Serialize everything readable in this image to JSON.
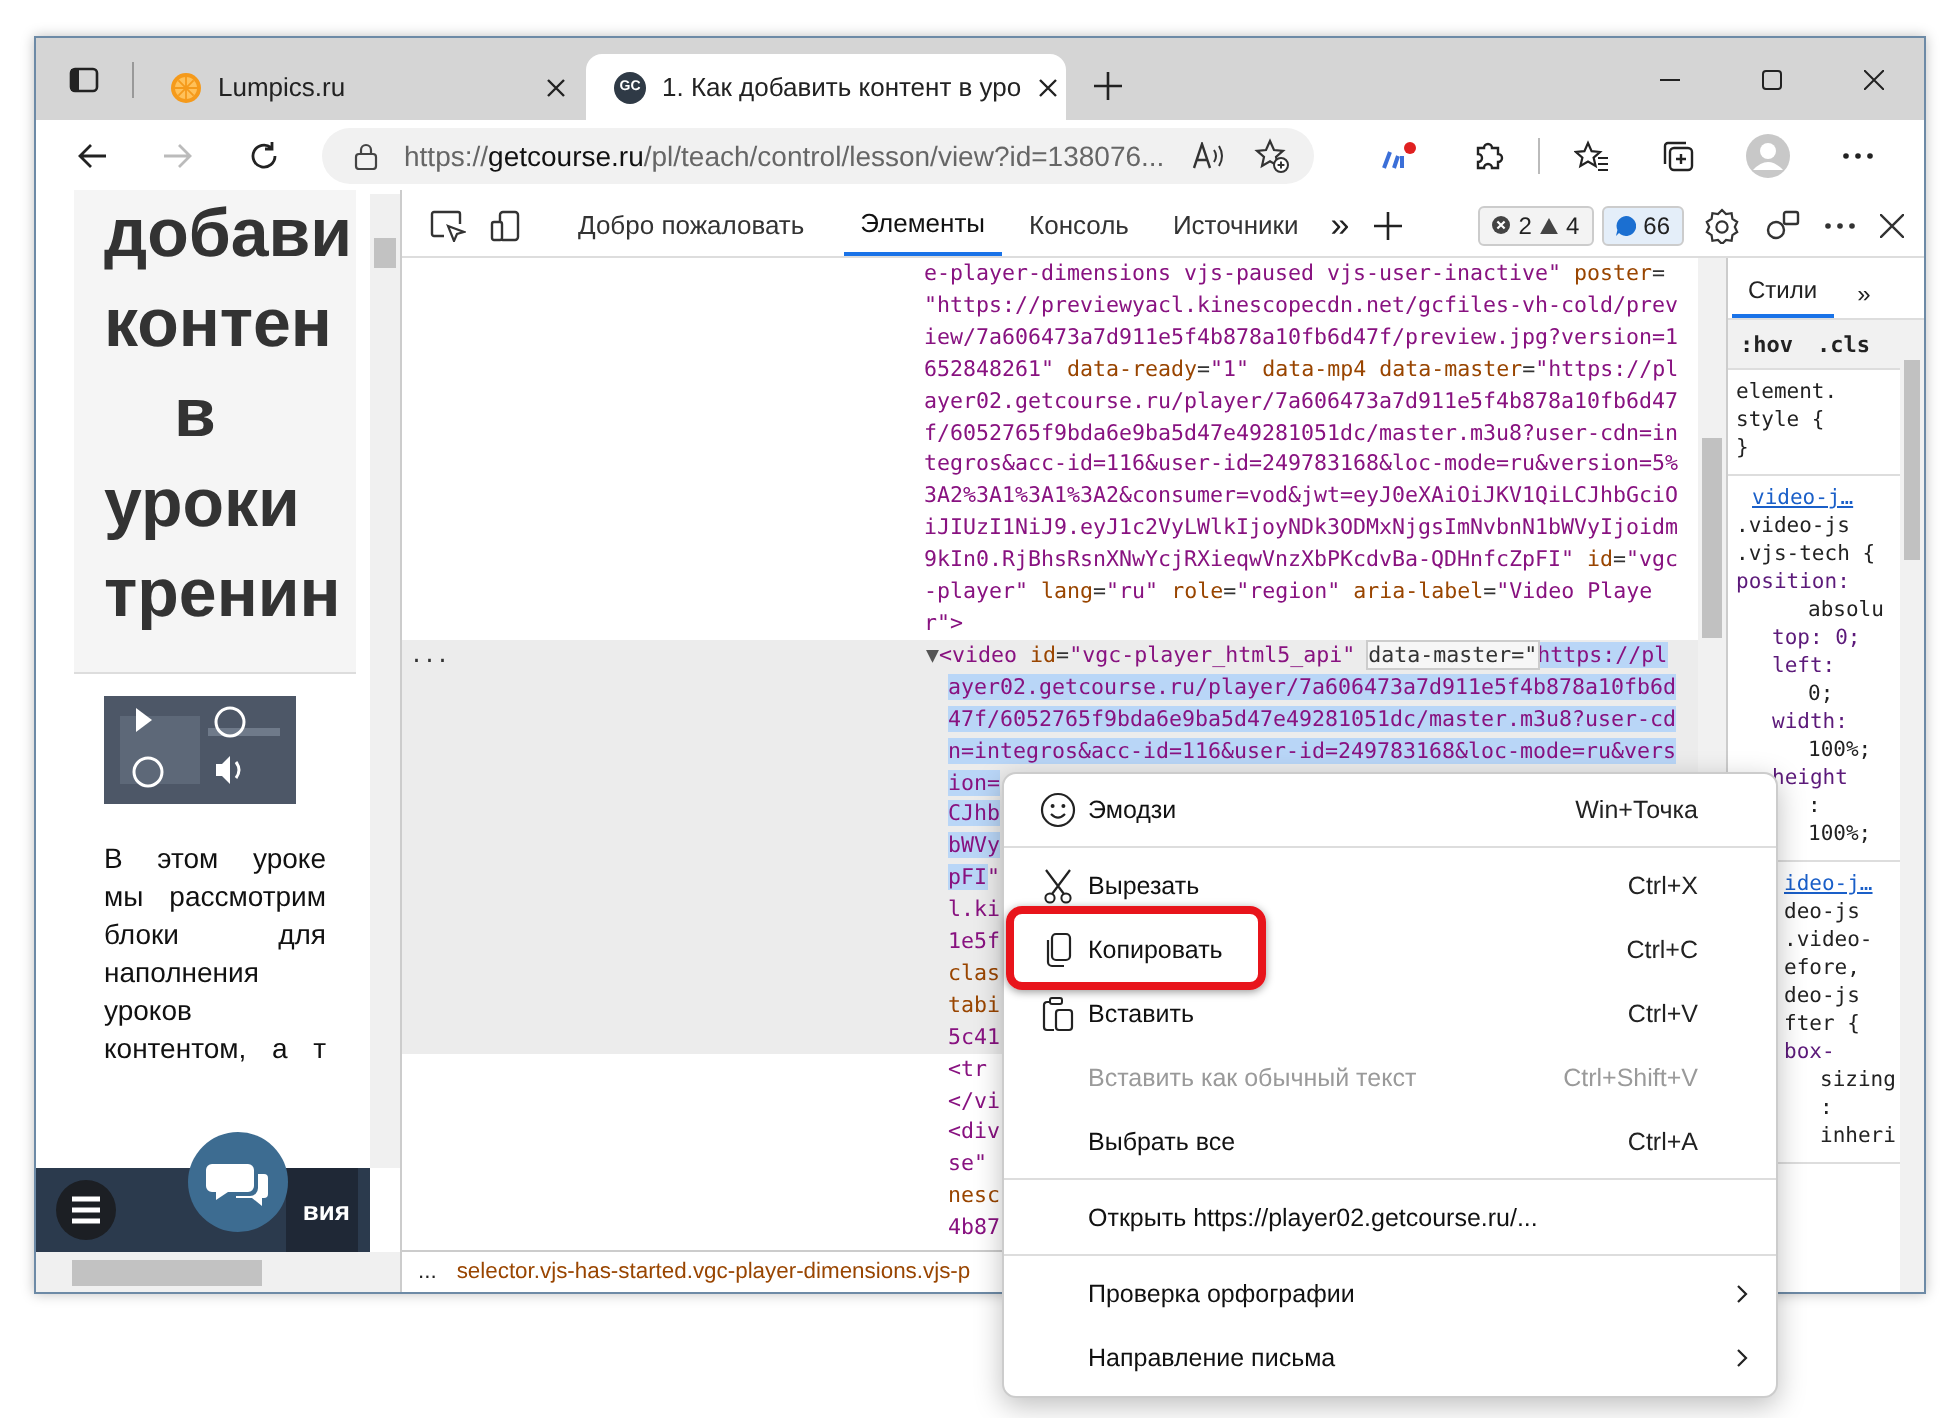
{
  "browser": {
    "tabs": [
      {
        "title": "Lumpics.ru",
        "selected": false,
        "kind": "orange"
      },
      {
        "title": "1. Как добавить контент в уро",
        "selected": true,
        "kind": "letters",
        "favicon_text": "GC"
      }
    ],
    "forward_disabled": true,
    "address": {
      "scheme": "https://",
      "domain": "getcourse.ru",
      "path": "/pl/teach/control/lesson/view?id=138076..."
    }
  },
  "page": {
    "heading_lines": [
      "добави",
      "контен",
      "в",
      "уроки",
      "тренин"
    ],
    "paragraph": "В этом уроке мы рассмотрим блоки для наполнения уроков контентом, а т",
    "bottom_bar_label": "вия"
  },
  "devtools": {
    "tabs": [
      {
        "label": "Добро пожаловать",
        "selected": false
      },
      {
        "label": "Элементы",
        "selected": true
      },
      {
        "label": "Консоль",
        "selected": false
      },
      {
        "label": "Источники",
        "selected": false
      }
    ],
    "overflow_label": "»",
    "errors": "2",
    "warnings": "4",
    "issues": "66",
    "node_marker": "...",
    "nodes": [
      {
        "selected": false,
        "lines": [
          [
            {
              "kind": "value",
              "text": "e-player-dimensions vjs-paused vjs-user-inactive\" "
            },
            {
              "kind": "attr",
              "text": "poster"
            },
            {
              "kind": "plain",
              "text": "="
            }
          ],
          [
            {
              "kind": "value",
              "text": "\"https://previewyacl.kinescopecdn.net/gcfiles-vh-cold/prev"
            }
          ],
          [
            {
              "kind": "value",
              "text": "iew/7a606473a7d911e5f4b878a10fb6d47f/preview.jpg?version=1"
            }
          ],
          [
            {
              "kind": "value",
              "text": "652848261\" "
            },
            {
              "kind": "attr",
              "text": "data-ready"
            },
            {
              "kind": "plain",
              "text": "="
            },
            {
              "kind": "value",
              "text": "\"1\" "
            },
            {
              "kind": "attr",
              "text": "data-mp4 data-master"
            },
            {
              "kind": "plain",
              "text": "="
            },
            {
              "kind": "value",
              "text": "\"https://pl"
            }
          ],
          [
            {
              "kind": "value",
              "text": "ayer02.getcourse.ru/player/7a606473a7d911e5f4b878a10fb6d47"
            }
          ],
          [
            {
              "kind": "value",
              "text": "f/6052765f9bda6e9ba5d47e49281051dc/master.m3u8?user-cdn=in"
            }
          ],
          [
            {
              "kind": "value",
              "text": "tegros&acc-id=116&user-id=249783168&loc-mode=ru&version=5%"
            }
          ],
          [
            {
              "kind": "value",
              "text": "3A2%3A1%3A1%3A2&consumer=vod&jwt=eyJ0eXAiOiJKV1QiLCJhbGciO"
            }
          ],
          [
            {
              "kind": "value",
              "text": "iJIUzI1NiJ9.eyJ1c2VyLWlkIjoyNDk3ODMxNjgsImNvbnN1bWVyIjoidm"
            }
          ],
          [
            {
              "kind": "value",
              "text": "9kIn0.RjBhsRsnXNwYcjRXieqwVnzXbPKcdvBa-QDHnfcZpFI\" "
            },
            {
              "kind": "attr",
              "text": "id"
            },
            {
              "kind": "plain",
              "text": "="
            },
            {
              "kind": "value",
              "text": "\"vgc"
            }
          ],
          [
            {
              "kind": "value",
              "text": "-player\" "
            },
            {
              "kind": "attr",
              "text": "lang"
            },
            {
              "kind": "plain",
              "text": "="
            },
            {
              "kind": "value",
              "text": "\"ru\" "
            },
            {
              "kind": "attr",
              "text": "role"
            },
            {
              "kind": "plain",
              "text": "="
            },
            {
              "kind": "value",
              "text": "\"region\" "
            },
            {
              "kind": "attr",
              "text": "aria-label"
            },
            {
              "kind": "plain",
              "text": "="
            },
            {
              "kind": "value",
              "text": "\"Video Playe"
            }
          ],
          [
            {
              "kind": "value",
              "text": "r\""
            },
            {
              "kind": "tag",
              "text": ">"
            }
          ]
        ]
      },
      {
        "selected": true,
        "lines": [
          [
            {
              "kind": "toggle",
              "text": "▼"
            },
            {
              "kind": "tag",
              "text": "<video "
            },
            {
              "kind": "attr",
              "text": "id"
            },
            {
              "kind": "plain",
              "text": "="
            },
            {
              "kind": "value",
              "text": "\"vgc-player_html5_api\" "
            },
            {
              "kind": "hover",
              "text": "data-master=\""
            },
            {
              "kind": "sel",
              "text": "https://pl"
            }
          ],
          [
            {
              "kind": "sel",
              "text": "ayer02.getcourse.ru/player/7a606473a7d911e5f4b878a10fb6d"
            }
          ],
          [
            {
              "kind": "sel",
              "text": "47f/6052765f9bda6e9ba5d47e49281051dc/master.m3u8?user-cd"
            }
          ],
          [
            {
              "kind": "sel",
              "text": "n=integros&acc-id=116&user-id=249783168&loc-mode=ru&vers"
            }
          ],
          [
            {
              "kind": "sel",
              "text": "ion="
            }
          ],
          [
            {
              "kind": "sel",
              "text": "CJhb"
            }
          ],
          [
            {
              "kind": "sel",
              "text": "bWVy"
            }
          ],
          [
            {
              "kind": "sel",
              "text": "pFI"
            },
            {
              "kind": "value",
              "text": "\""
            }
          ],
          [
            {
              "kind": "value",
              "text": "l.ki"
            }
          ],
          [
            {
              "kind": "value",
              "text": "1e5f"
            }
          ],
          [
            {
              "kind": "attr",
              "text": "clas"
            }
          ],
          [
            {
              "kind": "attr",
              "text": "tabi"
            }
          ],
          [
            {
              "kind": "value",
              "text": "5c41"
            }
          ]
        ]
      },
      {
        "selected": false,
        "lines": [
          [
            {
              "kind": "tag",
              "text": "<tr"
            }
          ],
          [
            {
              "kind": "tag",
              "text": "</vi"
            }
          ],
          [
            {
              "kind": "tag",
              "text": "<div"
            }
          ],
          [
            {
              "kind": "value",
              "text": "se\""
            }
          ],
          [
            {
              "kind": "attr",
              "text": "nesc"
            }
          ],
          [
            {
              "kind": "value",
              "text": "4b87"
            }
          ]
        ]
      }
    ],
    "breadcrumb": {
      "more": "...",
      "path": "selector.vjs-has-started.vgc-player-dimensions.vjs-p"
    },
    "styles": {
      "tabs": [
        {
          "label": "Стили",
          "selected": true
        },
        {
          "label": "»",
          "selected": false
        }
      ],
      "filters": [
        ":hov",
        ".cls"
      ],
      "rules": [
        {
          "obscured": false,
          "lines": [
            {
              "kind": "selector",
              "text": "element."
            },
            {
              "kind": "selector",
              "text": "style {"
            },
            {
              "kind": "selector",
              "text": "}"
            }
          ]
        },
        {
          "obscured": false,
          "lines": [
            {
              "kind": "link",
              "text": "video-j…"
            },
            {
              "kind": "selector",
              "text": ".video-js"
            },
            {
              "kind": "selector",
              "text": ".vjs-tech {"
            },
            {
              "kind": "prop",
              "text": "position:"
            },
            {
              "kind": "value",
              "text": "absolu"
            },
            {
              "kind": "subprop",
              "text": "top: 0;"
            },
            {
              "kind": "subprop",
              "text": "left:"
            },
            {
              "kind": "value",
              "text": "0;"
            },
            {
              "kind": "subprop",
              "text": "width:"
            },
            {
              "kind": "value",
              "text": "100%;"
            },
            {
              "kind": "subprop",
              "text": "height"
            },
            {
              "kind": "value",
              "text": ":"
            },
            {
              "kind": "value",
              "text": "100%;"
            }
          ]
        },
        {
          "obscured": true,
          "lines": [
            {
              "kind": "link",
              "text": "ideo-j…"
            },
            {
              "kind": "selector",
              "text": "deo-js"
            },
            {
              "kind": "selector",
              "text": ".video-"
            },
            {
              "kind": "selector",
              "text": "efore,"
            },
            {
              "kind": "selector",
              "text": "deo-js"
            },
            {
              "kind": "selector",
              "text": "fter {"
            },
            {
              "kind": "subprop",
              "text": "box-"
            },
            {
              "kind": "value",
              "text": "sizing"
            },
            {
              "kind": "value",
              "text": ":"
            },
            {
              "kind": "value",
              "text": "inheri"
            }
          ]
        }
      ]
    }
  },
  "context_menu": {
    "items": [
      {
        "kind": "emoji",
        "label": "Эмодзи",
        "shortcut": "Win+Точка",
        "disabled": false,
        "callout": false
      },
      {
        "kind": "separator"
      },
      {
        "kind": "scissors",
        "label": "Вырезать",
        "shortcut": "Ctrl+X",
        "disabled": false,
        "callout": false
      },
      {
        "kind": "copy",
        "label": "Копировать",
        "shortcut": "Ctrl+C",
        "disabled": false,
        "callout": true
      },
      {
        "kind": "paste",
        "label": "Вставить",
        "shortcut": "Ctrl+V",
        "disabled": false,
        "callout": false
      },
      {
        "kind": "plain",
        "label": "Вставить как обычный текст",
        "shortcut": "Ctrl+Shift+V",
        "disabled": true,
        "callout": false
      },
      {
        "kind": "plain",
        "label": "Выбрать все",
        "shortcut": "Ctrl+A",
        "disabled": false,
        "callout": false
      },
      {
        "kind": "separator"
      },
      {
        "kind": "plain",
        "label": "Открыть https://player02.getcourse.ru/...",
        "disabled": false,
        "callout": false
      },
      {
        "kind": "separator"
      },
      {
        "kind": "submenu",
        "label": "Проверка орфографии",
        "disabled": false,
        "callout": false
      },
      {
        "kind": "submenu",
        "label": "Направление письма",
        "disabled": false,
        "callout": false
      }
    ]
  }
}
